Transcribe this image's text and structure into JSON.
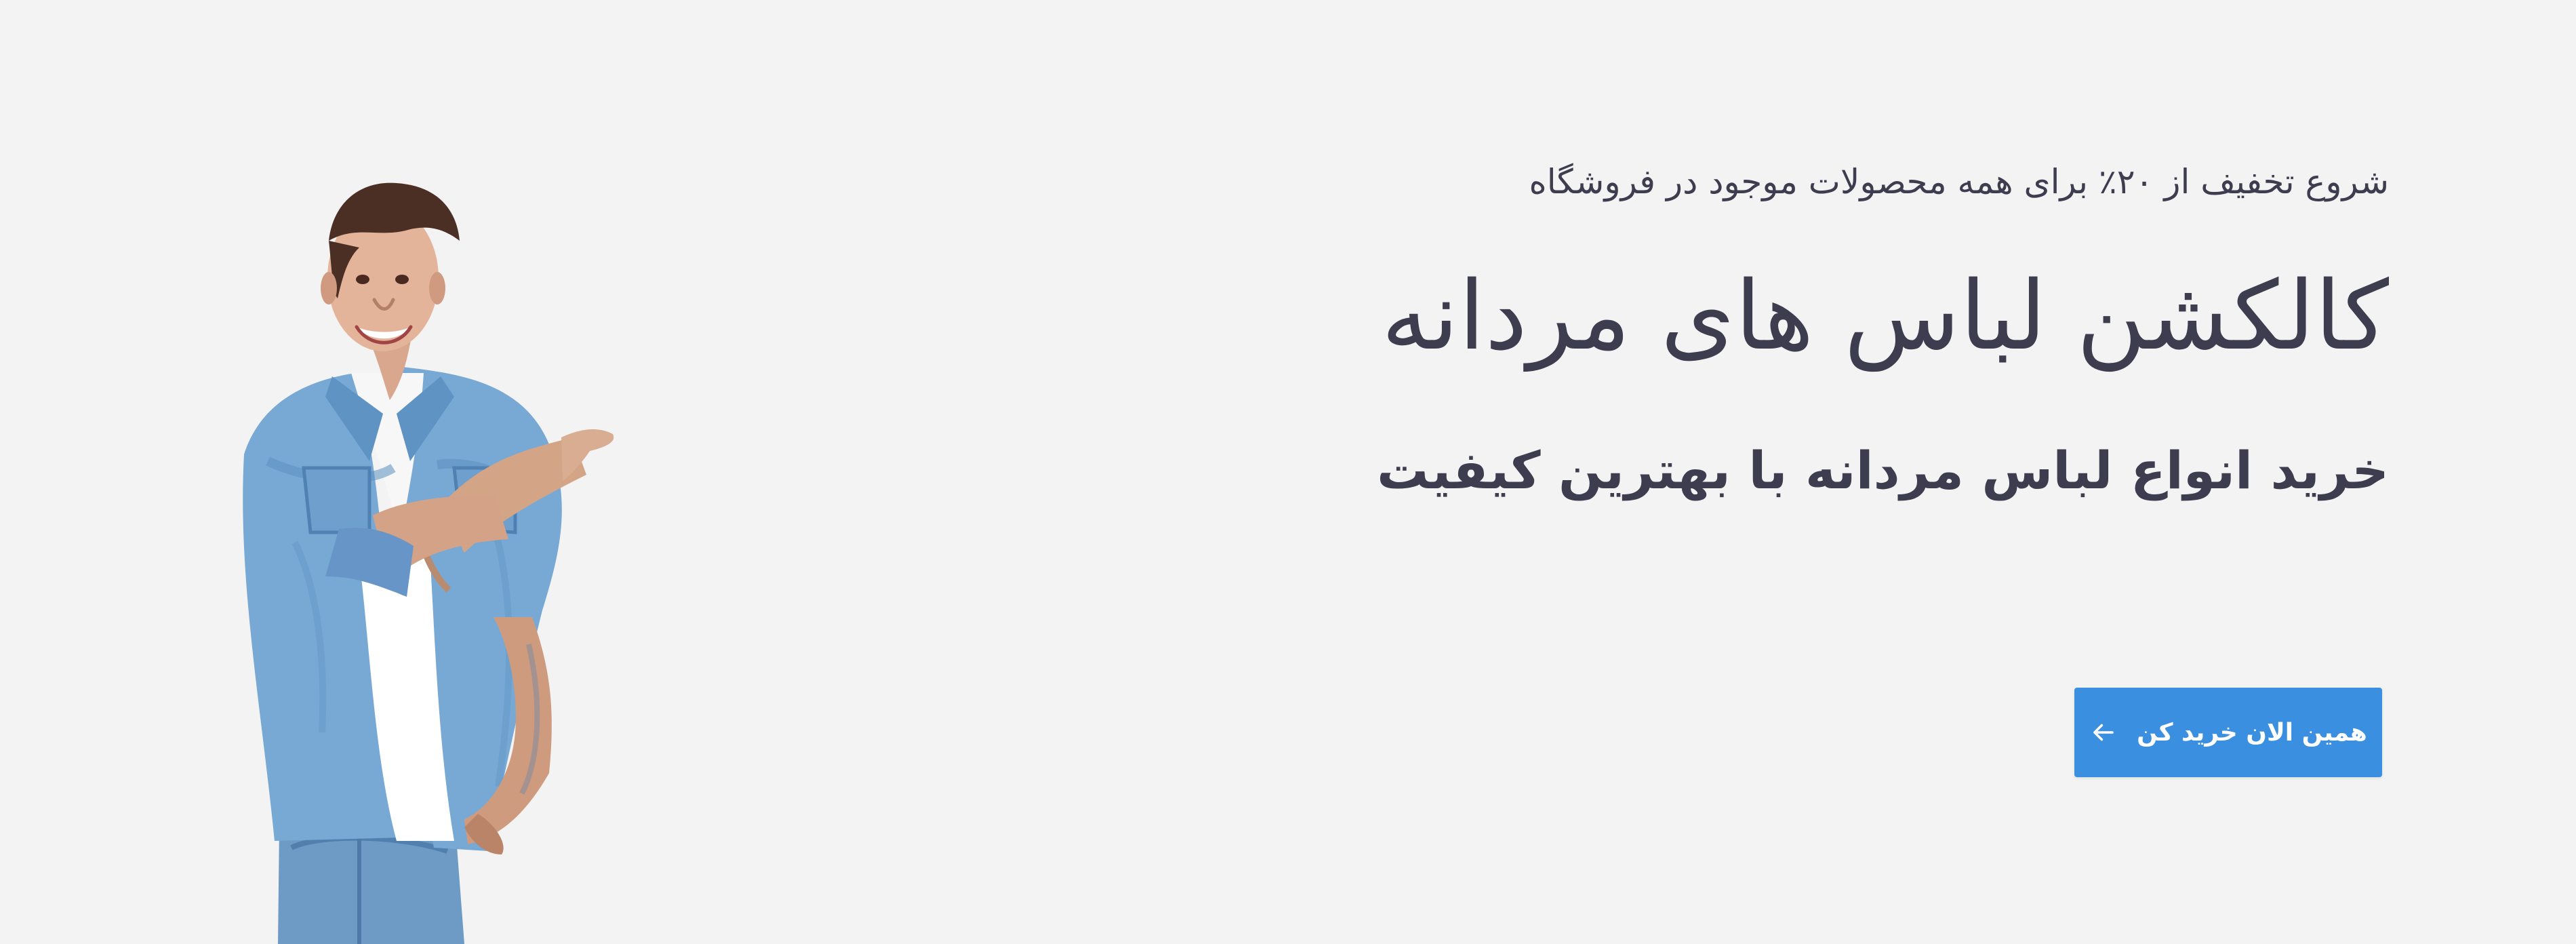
{
  "hero": {
    "eyebrow": "شروع تخفیف از ۲۰٪ برای همه محصولات موجود در فروشگاه",
    "title": "کالکشن لباس های مردانه",
    "subtitle": "خرید انواع لباس مردانه با بهترین کیفیت",
    "cta_label": "همین الان خرید کن",
    "cta_icon": "arrow-left-icon",
    "image_icon": "man-pointing-photo"
  },
  "colors": {
    "background": "#f3f3f3",
    "text": "#3e3d4f",
    "accent": "#3b8fe0"
  }
}
